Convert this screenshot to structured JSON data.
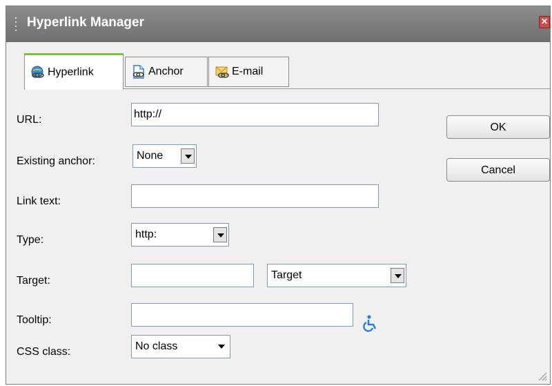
{
  "window": {
    "title": "Hyperlink Manager",
    "close_label": "✕"
  },
  "tabs": [
    {
      "label": "Hyperlink",
      "icon": "globe-link-icon"
    },
    {
      "label": "Anchor",
      "icon": "page-anchor-icon"
    },
    {
      "label": "E-mail",
      "icon": "envelope-link-icon"
    }
  ],
  "form": {
    "url": {
      "label": "URL:",
      "value": "http://"
    },
    "existing_anchor": {
      "label": "Existing anchor:",
      "selected": "None"
    },
    "link_text": {
      "label": "Link text:",
      "value": ""
    },
    "type": {
      "label": "Type:",
      "selected": "http:"
    },
    "target": {
      "label": "Target:",
      "value": "",
      "selected": "Target"
    },
    "tooltip": {
      "label": "Tooltip:",
      "value": "",
      "icon": "accessibility-icon"
    },
    "css_class": {
      "label": "CSS class:",
      "selected": "No class"
    }
  },
  "buttons": {
    "ok": "OK",
    "cancel": "Cancel"
  },
  "colors": {
    "titlebar": "#7f7f7f",
    "active_tab_accent": "#7cbf3c",
    "field_border": "#7f9db9",
    "accessibility_icon": "#2a7fd4"
  }
}
